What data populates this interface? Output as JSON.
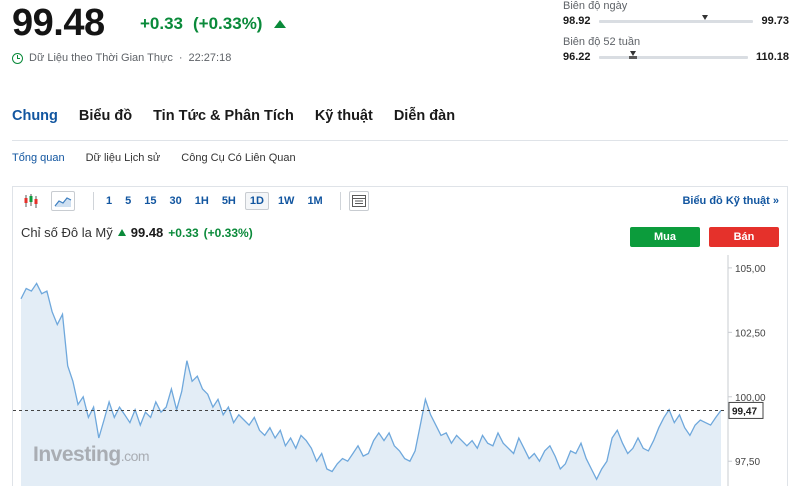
{
  "header": {
    "price": "99.48",
    "change": "+0.33",
    "change_pct": "(+0.33%)",
    "realtime_label": "Dữ Liệu theo Thời Gian Thực",
    "time": "22:27:18",
    "accent_up": "#0a8a3a"
  },
  "ranges": {
    "day": {
      "label": "Biên độ ngày",
      "low": "98.92",
      "high": "99.73",
      "marker_fraction": 0.69
    },
    "week52": {
      "label": "Biên độ 52 tuần",
      "low": "96.22",
      "high": "110.18",
      "marker_fraction": 0.23
    }
  },
  "main_tabs": [
    {
      "label": "Chung",
      "active": true
    },
    {
      "label": "Biểu đồ",
      "active": false
    },
    {
      "label": "Tin Tức & Phân Tích",
      "active": false
    },
    {
      "label": "Kỹ thuật",
      "active": false
    },
    {
      "label": "Diễn đàn",
      "active": false
    }
  ],
  "sub_tabs": [
    {
      "label": "Tổng quan",
      "active": true
    },
    {
      "label": "Dữ liệu Lịch sử",
      "active": false
    },
    {
      "label": "Công Cụ Có Liên Quan",
      "active": false
    }
  ],
  "toolbar": {
    "icons": [
      "candlestick-icon",
      "area-chart-icon"
    ],
    "intervals": [
      {
        "label": "1",
        "active": false
      },
      {
        "label": "5",
        "active": false
      },
      {
        "label": "15",
        "active": false
      },
      {
        "label": "30",
        "active": false
      },
      {
        "label": "1H",
        "active": false
      },
      {
        "label": "5H",
        "active": false
      },
      {
        "label": "1D",
        "active": true
      },
      {
        "label": "1W",
        "active": false
      },
      {
        "label": "1M",
        "active": false
      }
    ],
    "technical_link": "Biểu đồ Kỹ thuật »"
  },
  "instrument": {
    "name": "Chỉ số Đô la Mỹ",
    "price": "99.48",
    "change": "+0.33",
    "change_pct": "(+0.33%)",
    "buy_label": "Mua",
    "sell_label": "Bán",
    "buy_color": "#0c9c3c",
    "sell_color": "#e5312b"
  },
  "watermark": {
    "brand": "Investing",
    "suffix": ".com"
  },
  "chart_data": {
    "type": "area",
    "ylim": [
      96.5,
      105.5
    ],
    "yticks": [
      {
        "value": 105.0,
        "label": "105,00"
      },
      {
        "value": 102.5,
        "label": "102,50"
      },
      {
        "value": 100.0,
        "label": "100,00"
      },
      {
        "value": 97.5,
        "label": "97,50"
      }
    ],
    "last_value": 99.47,
    "last_label": "99,47",
    "line_color": "#6fa8dc",
    "fill_color": "#e3edf6",
    "values": [
      103.8,
      104.2,
      104.1,
      104.4,
      104.0,
      104.1,
      103.3,
      102.8,
      103.2,
      101.2,
      100.6,
      99.7,
      100.0,
      99.2,
      99.6,
      98.4,
      99.1,
      99.8,
      99.2,
      99.6,
      99.3,
      99.0,
      99.5,
      98.9,
      99.4,
      99.2,
      99.8,
      99.4,
      99.6,
      100.3,
      99.5,
      100.2,
      101.4,
      100.6,
      100.8,
      100.3,
      100.1,
      99.6,
      99.9,
      99.3,
      99.6,
      99.0,
      99.3,
      99.1,
      98.9,
      99.2,
      98.7,
      98.5,
      98.8,
      98.4,
      98.7,
      98.1,
      98.4,
      98.0,
      98.5,
      98.3,
      98.0,
      97.5,
      97.8,
      97.2,
      97.1,
      97.4,
      97.6,
      97.5,
      97.8,
      98.1,
      97.7,
      97.8,
      98.3,
      98.6,
      98.3,
      98.6,
      98.1,
      97.9,
      97.6,
      97.5,
      97.9,
      98.9,
      99.9,
      99.3,
      98.9,
      98.5,
      98.6,
      98.2,
      98.5,
      98.3,
      98.1,
      98.3,
      98.0,
      98.5,
      98.2,
      98.1,
      98.6,
      98.2,
      98.0,
      97.8,
      98.4,
      98.0,
      97.6,
      97.8,
      97.5,
      97.9,
      98.1,
      97.7,
      97.2,
      97.4,
      97.9,
      97.8,
      98.2,
      97.6,
      97.2,
      96.8,
      97.2,
      97.5,
      98.4,
      98.7,
      98.2,
      97.8,
      98.0,
      98.4,
      98.0,
      97.9,
      98.3,
      98.8,
      99.2,
      99.5,
      99.0,
      99.3,
      98.8,
      98.5,
      98.9,
      99.1,
      99.0,
      98.9,
      99.2,
      99.47
    ]
  }
}
